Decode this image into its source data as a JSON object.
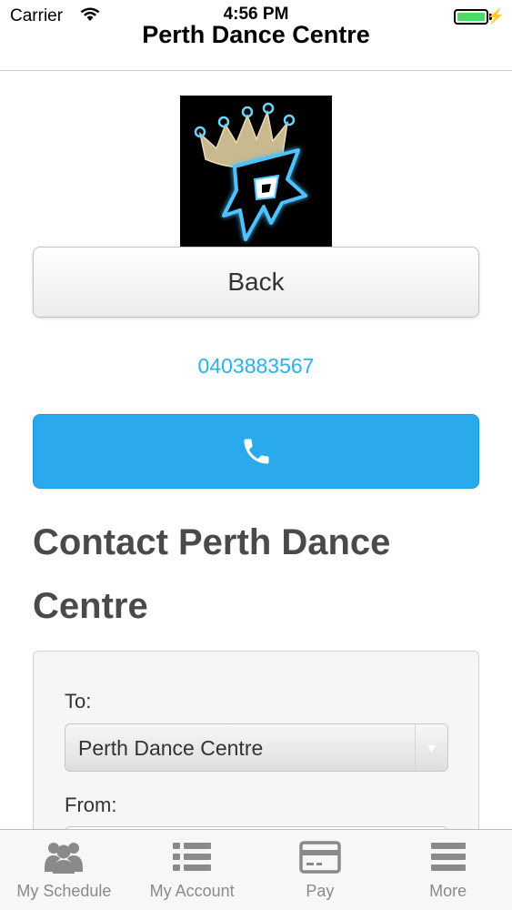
{
  "status_bar": {
    "carrier": "Carrier",
    "time": "4:56 PM",
    "battery_color": "#4cd964"
  },
  "nav": {
    "title": "Perth Dance Centre"
  },
  "logo": {
    "icon": "crown-p-logo",
    "text": "P"
  },
  "back_button": {
    "label": "Back"
  },
  "phone": {
    "number": "0403883567",
    "link_color": "#2ab1e8"
  },
  "call_button": {
    "icon": "phone-icon",
    "color": "#2aa9ec"
  },
  "contact": {
    "heading": "Contact Perth Dance Centre",
    "to_label": "To:",
    "to_value": "Perth Dance Centre",
    "from_label": "From:"
  },
  "tab_bar": {
    "items": [
      {
        "label": "My Schedule",
        "icon": "people-icon"
      },
      {
        "label": "My Account",
        "icon": "list-icon"
      },
      {
        "label": "Pay",
        "icon": "credit-card-icon"
      },
      {
        "label": "More",
        "icon": "menu-icon"
      }
    ]
  }
}
